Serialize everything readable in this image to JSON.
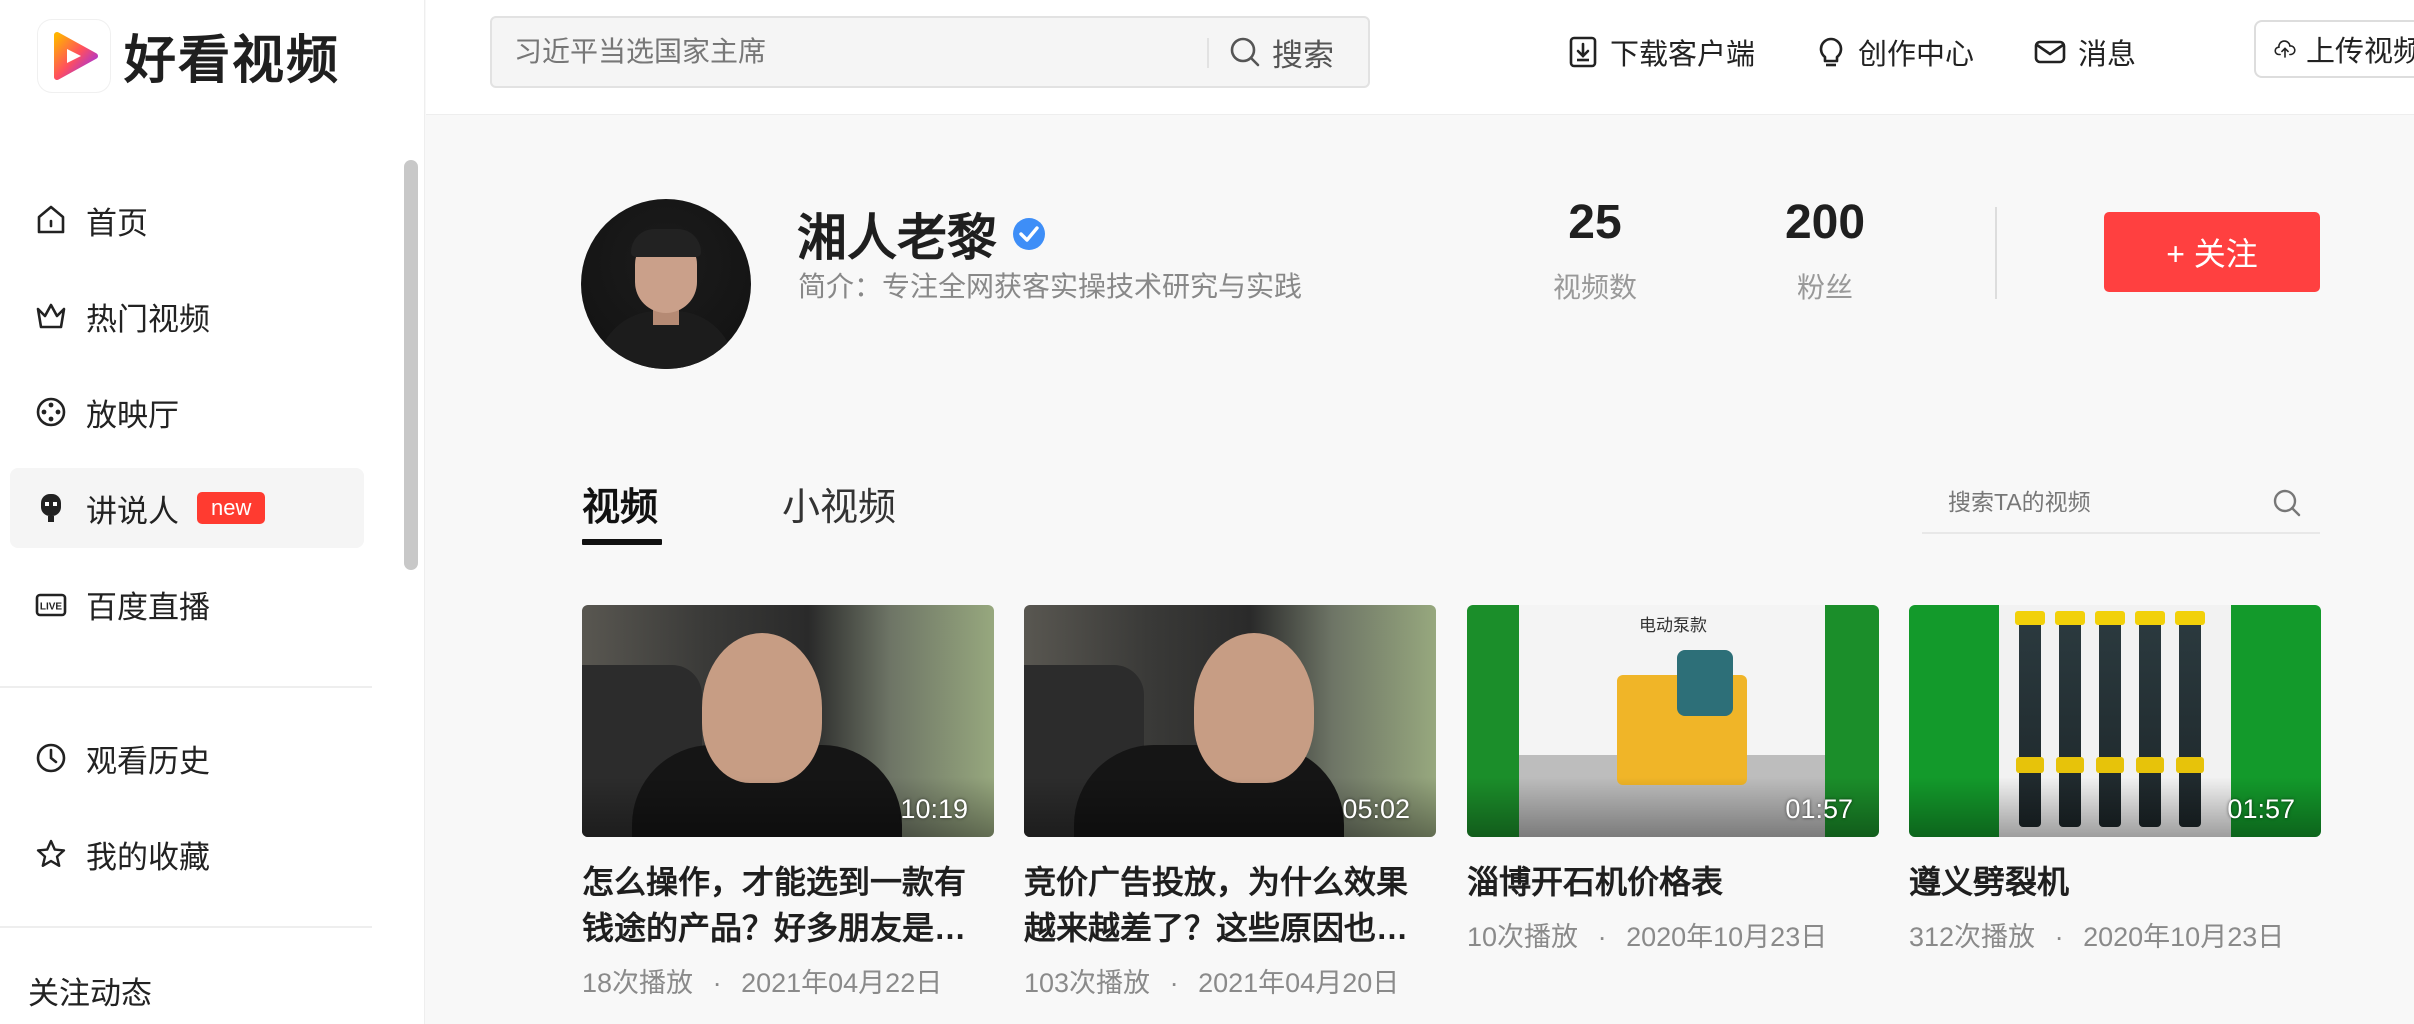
{
  "brand": {
    "name": "好看视频"
  },
  "search": {
    "placeholder": "习近平当选国家主席",
    "button_label": "搜索"
  },
  "header_links": [
    {
      "label": "下载客户端",
      "icon": "download-icon"
    },
    {
      "label": "创作中心",
      "icon": "lightbulb-icon"
    },
    {
      "label": "消息",
      "icon": "mail-icon"
    }
  ],
  "upload": {
    "label": "上传视频",
    "icon": "cloud-upload-icon"
  },
  "sidebar": {
    "items": [
      {
        "label": "首页",
        "icon": "home-icon"
      },
      {
        "label": "热门视频",
        "icon": "crown-icon"
      },
      {
        "label": "放映厅",
        "icon": "film-reel-icon"
      },
      {
        "label": "讲说人",
        "icon": "speaker-icon",
        "badge": "new",
        "active": true
      },
      {
        "label": "百度直播",
        "icon": "live-icon"
      }
    ],
    "secondary": [
      {
        "label": "观看历史",
        "icon": "clock-icon"
      },
      {
        "label": "我的收藏",
        "icon": "star-icon"
      }
    ],
    "section_title": "关注动态"
  },
  "profile": {
    "name": "湘人老黎",
    "intro": "简介：专注全网获客实操技术研究与实践",
    "stats": [
      {
        "value": "25",
        "label": "视频数"
      },
      {
        "value": "200",
        "label": "粉丝"
      }
    ],
    "follow_label": "+ 关注"
  },
  "tabs": [
    {
      "label": "视频",
      "active": true
    },
    {
      "label": "小视频",
      "active": false
    }
  ],
  "video_search": {
    "placeholder": "搜索TA的视频"
  },
  "videos": [
    {
      "title": "怎么操作，才能选到一款有钱途的产品？好多朋友是…",
      "duration": "10:19",
      "plays": "18次播放",
      "date": "2021年04月22日"
    },
    {
      "title": "竞价广告投放，为什么效果越来越差了？这些原因也…",
      "duration": "05:02",
      "plays": "103次播放",
      "date": "2021年04月20日"
    },
    {
      "title": "淄博开石机价格表",
      "duration": "01:57",
      "plays": "10次播放",
      "date": "2020年10月23日",
      "thumb_label": "电动泵款"
    },
    {
      "title": "遵义劈裂机",
      "duration": "01:57",
      "plays": "312次播放",
      "date": "2020年10月23日"
    }
  ],
  "meta_separator": "·",
  "colors": {
    "accent": "#ff4040",
    "verified": "#3e8ef7",
    "badge": "#ff3b30"
  }
}
